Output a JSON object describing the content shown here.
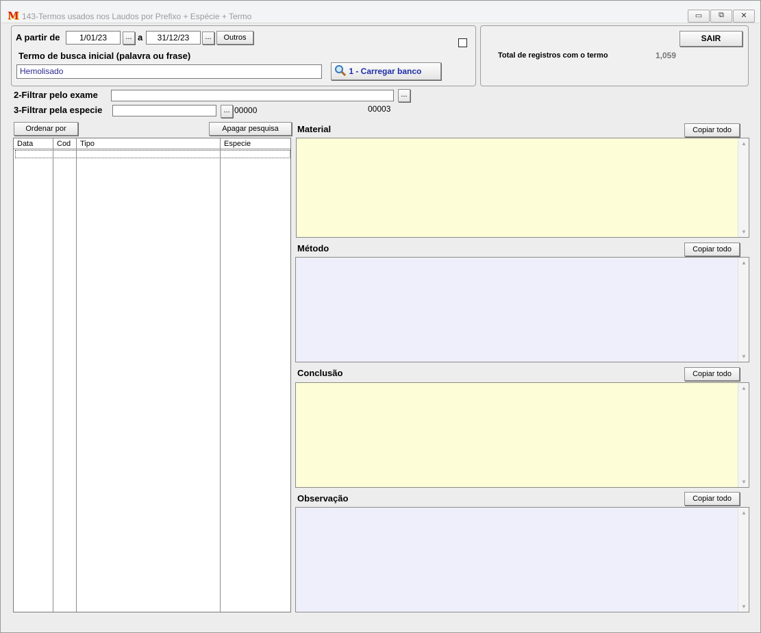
{
  "window": {
    "title": "143-Termos usados nos Laudos por  Prefixo +  Espécie + Termo",
    "app_icon": "M",
    "minimize": "▭",
    "restore": "⧉",
    "close": "✕"
  },
  "search": {
    "from_label": "A partir de",
    "date_from": "1/01/23",
    "to_label": "a",
    "date_to": "31/12/23",
    "dots": "...",
    "other_button": "Outros",
    "term_label": "Termo de busca inicial (palavra ou frase)",
    "term_value": "Hemolisado",
    "load_button": "1 - Carregar banco"
  },
  "summary": {
    "exit_button": "SAIR",
    "total_label": "Total de registros com o termo",
    "total_value": "1,059"
  },
  "filters": {
    "exam_label": "2-Filtrar pelo exame",
    "exam_value": "",
    "species_label": "3-Filtrar pela especie",
    "species_value": "",
    "species_code": "00000",
    "count": "00003"
  },
  "list": {
    "order_button": "Ordenar por",
    "clear_button": "Apagar pesquisa",
    "columns": [
      "Data",
      "Cod",
      "Tipo",
      "Especie"
    ]
  },
  "sections": [
    {
      "label": "Material",
      "copy": "Copiar todo",
      "color": "#fdfdd8"
    },
    {
      "label": "Método",
      "copy": "Copiar todo",
      "color": "#efeffb"
    },
    {
      "label": "Conclusão",
      "copy": "Copiar todo",
      "color": "#fdfdd8"
    },
    {
      "label": "Observação",
      "copy": "Copiar todo",
      "color": "#efeffb"
    }
  ]
}
